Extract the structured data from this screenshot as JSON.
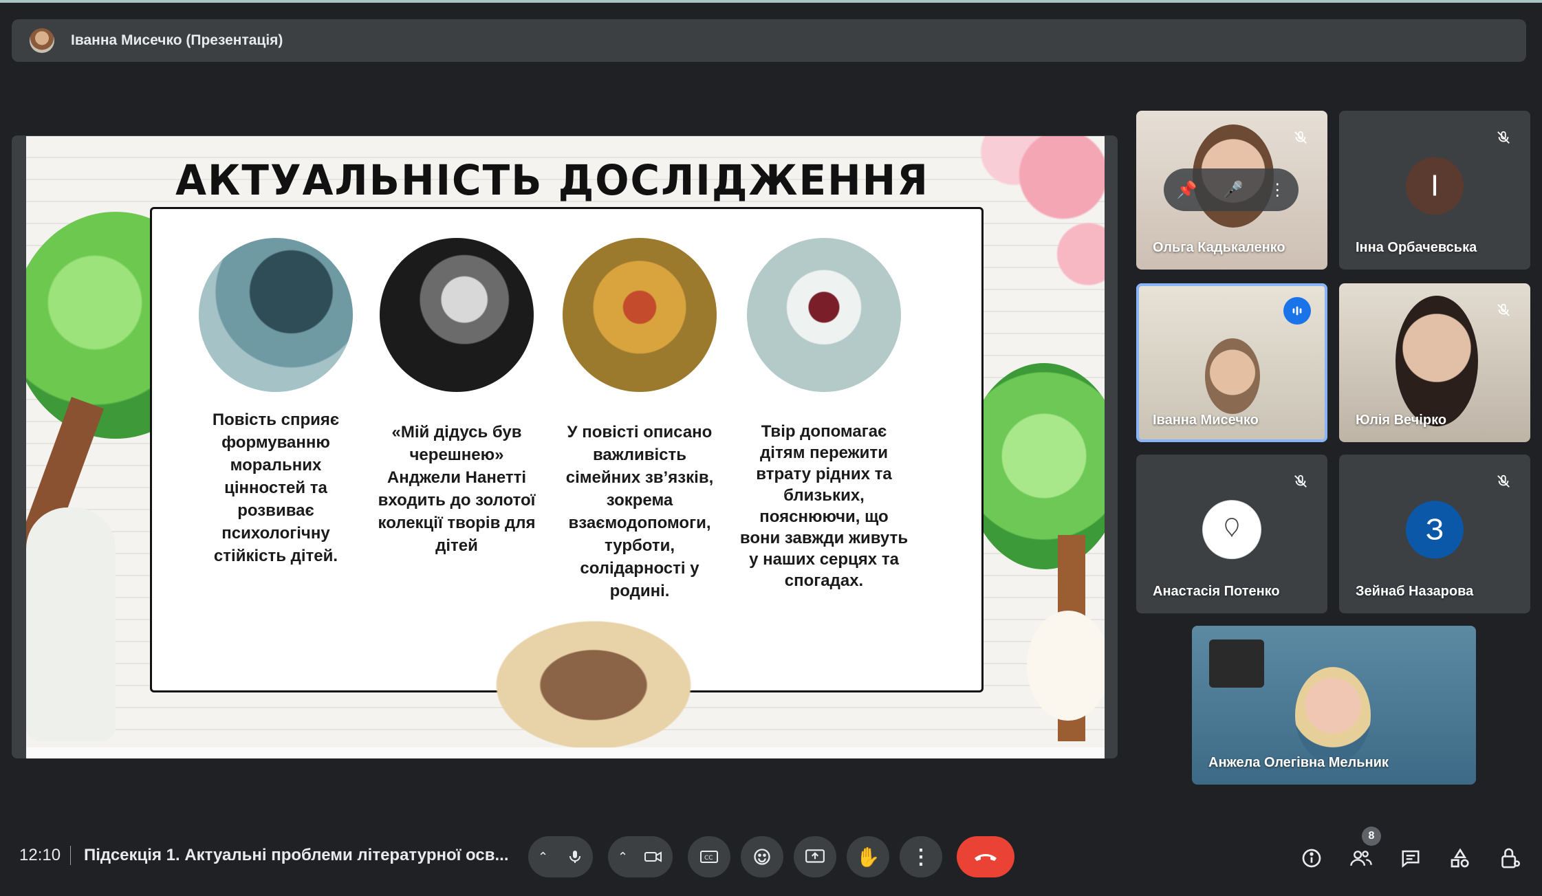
{
  "presenter_bar": {
    "label": "Іванна Мисечко (Презентація)"
  },
  "slide": {
    "title": "АКТУАЛЬНІСТЬ ДОСЛІДЖЕННЯ",
    "columns": [
      {
        "caption": "Повість сприяє формуванню моральних цінностей та розвиває психологічну стійкість дітей."
      },
      {
        "caption": "«Мій дідусь був черешнею» Анджели Нанетті входить до золотої колекції творів для дітей"
      },
      {
        "caption": "У повісті описано важливість сімейних зв’язків, зокрема взаємодопомоги, турботи, солідарності у родині."
      },
      {
        "caption": "Твір допомагає дітям пережити втрату рідних та близьких, пояснюючи, що вони завжди живуть у наших серцях та спогадах."
      }
    ]
  },
  "participants": [
    {
      "name": "Ольга Кадькаленко",
      "muted": true
    },
    {
      "name": "Інна Орбачевська",
      "initial": "І",
      "avatar_color": "#5b3a2f",
      "muted": true
    },
    {
      "name": "Іванна Мисечко",
      "speaking": true
    },
    {
      "name": "Юлія Вечірко",
      "muted": true
    },
    {
      "name": "Анастасія Потенко",
      "muted": true
    },
    {
      "name": "Зейнаб Назарова",
      "initial": "З",
      "avatar_color": "#0b57a8",
      "muted": true
    },
    {
      "name": "Анжела Олегівна Мельник"
    }
  ],
  "bottom_bar": {
    "time": "12:10",
    "meeting_title": "Підсекція 1. Актуальні проблеми літературної осв...",
    "participants_count": "8"
  },
  "colors": {
    "background": "#202124",
    "tile": "#3c4043",
    "end_call": "#ea4335",
    "accent": "#1a73e8"
  }
}
